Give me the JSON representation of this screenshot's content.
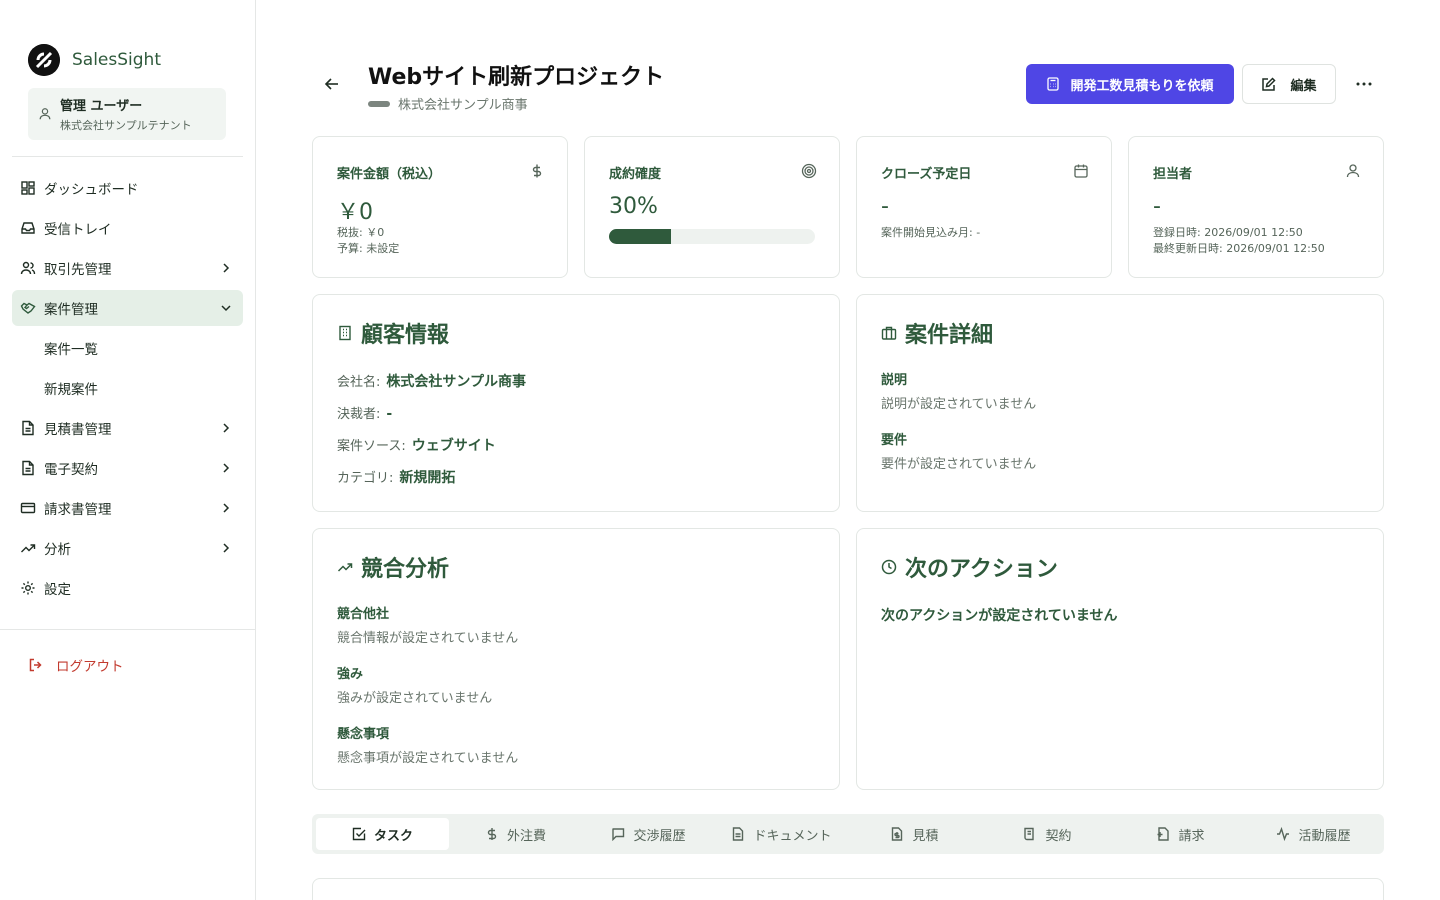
{
  "brand": {
    "name": "SalesSight"
  },
  "user": {
    "name": "管理 ユーザー",
    "tenant": "株式会社サンプルテナント"
  },
  "sidebar": {
    "items": [
      {
        "label": "ダッシュボード",
        "icon": "dashboard-icon"
      },
      {
        "label": "受信トレイ",
        "icon": "inbox-icon"
      },
      {
        "label": "取引先管理",
        "icon": "users-icon",
        "expandable": true
      },
      {
        "label": "案件管理",
        "icon": "handshake-icon",
        "expanded": true,
        "active": true
      },
      {
        "label": "見積書管理",
        "icon": "file-icon",
        "expandable": true
      },
      {
        "label": "電子契約",
        "icon": "file-icon",
        "expandable": true
      },
      {
        "label": "請求書管理",
        "icon": "credit-card-icon",
        "expandable": true
      },
      {
        "label": "分析",
        "icon": "trending-up-icon",
        "expandable": true
      },
      {
        "label": "設定",
        "icon": "gear-icon"
      }
    ],
    "sub_items": [
      {
        "label": "案件一覧"
      },
      {
        "label": "新規案件"
      }
    ],
    "logout": "ログアウト"
  },
  "header": {
    "title": "Webサイト刷新プロジェクト",
    "company": "株式会社サンプル商事",
    "primary_button": "開発工数見積もりを依頼",
    "edit_button": "編集"
  },
  "stats": {
    "amount": {
      "label": "案件金額（税込）",
      "value": "￥0",
      "tax_excluded": "税抜: ￥0",
      "budget": "予算: 未設定"
    },
    "probability": {
      "label": "成約確度",
      "value": "30%",
      "percent": 30
    },
    "close_date": {
      "label": "クローズ予定日",
      "value": "-",
      "start_month": "案件開始見込み月: -"
    },
    "owner": {
      "label": "担当者",
      "value": "-",
      "created": "登録日時: 2026/09/01 12:50",
      "updated": "最終更新日時: 2026/09/01 12:50"
    }
  },
  "customer": {
    "title": "顧客情報",
    "rows": [
      {
        "key": "会社名:",
        "value": "株式会社サンプル商事"
      },
      {
        "key": "決裁者:",
        "value": "-"
      },
      {
        "key": "案件ソース:",
        "value": "ウェブサイト"
      },
      {
        "key": "カテゴリ:",
        "value": "新規開拓"
      }
    ]
  },
  "details": {
    "title": "案件詳細",
    "description_label": "説明",
    "description_value": "説明が設定されていません",
    "requirements_label": "要件",
    "requirements_value": "要件が設定されていません"
  },
  "competition": {
    "title": "競合分析",
    "competitors_label": "競合他社",
    "competitors_value": "競合情報が設定されていません",
    "strengths_label": "強み",
    "strengths_value": "強みが設定されていません",
    "concerns_label": "懸念事項",
    "concerns_value": "懸念事項が設定されていません"
  },
  "next_action": {
    "title": "次のアクション",
    "value": "次のアクションが設定されていません"
  },
  "tabs": [
    {
      "label": "タスク",
      "icon": "check-square-icon",
      "active": true
    },
    {
      "label": "外注費",
      "icon": "dollar-icon"
    },
    {
      "label": "交渉履歴",
      "icon": "message-icon"
    },
    {
      "label": "ドキュメント",
      "icon": "document-icon"
    },
    {
      "label": "見積",
      "icon": "quote-icon"
    },
    {
      "label": "契約",
      "icon": "contract-icon"
    },
    {
      "label": "請求",
      "icon": "invoice-icon"
    },
    {
      "label": "活動履歴",
      "icon": "activity-icon"
    }
  ],
  "colors": {
    "accent": "#4f46e5",
    "brand_green": "#2f5a3c",
    "danger": "#c23a2e"
  }
}
